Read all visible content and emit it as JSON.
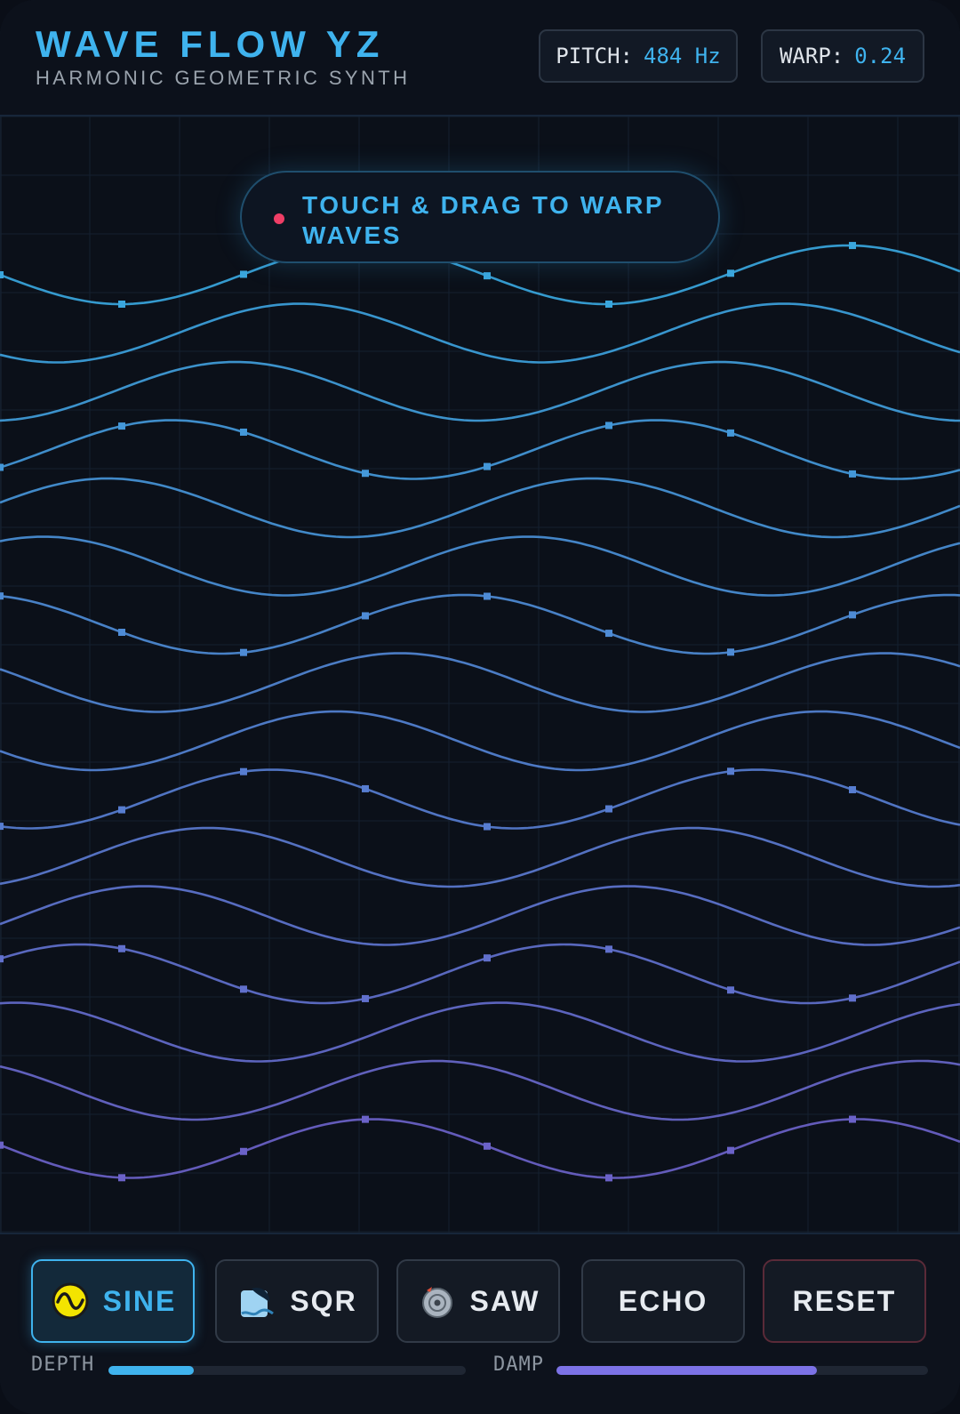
{
  "header": {
    "title": "WAVE FLOW YZ",
    "subtitle": "HARMONIC GEOMETRIC SYNTH",
    "pitch_label": "PITCH:",
    "pitch_value": "484 Hz",
    "warp_label": "WARP:",
    "warp_value": "0.24"
  },
  "hint": {
    "text": "TOUCH & DRAG TO WARP WAVES"
  },
  "waves": {
    "count": 16,
    "color_top": "#3aa6dd",
    "color_bottom": "#6b62c8"
  },
  "footer": {
    "buttons": [
      {
        "label": "SINE",
        "icon": "sine-wave-icon",
        "active": true
      },
      {
        "label": "SQR",
        "icon": "square-wave-icon",
        "active": false
      },
      {
        "label": "SAW",
        "icon": "saw-blade-icon",
        "active": false
      },
      {
        "label": "ECHO",
        "icon": "",
        "active": false
      },
      {
        "label": "RESET",
        "icon": "",
        "active": false
      }
    ],
    "depth_label": "DEPTH",
    "depth_value": 0.24,
    "damp_label": "DAMP",
    "damp_value": 0.7
  },
  "colors": {
    "accent": "#3fb3ee",
    "accent_purple": "#7c72e6",
    "alert_dot": "#ef3e66",
    "sine_icon_yellow": "#f3e400"
  }
}
